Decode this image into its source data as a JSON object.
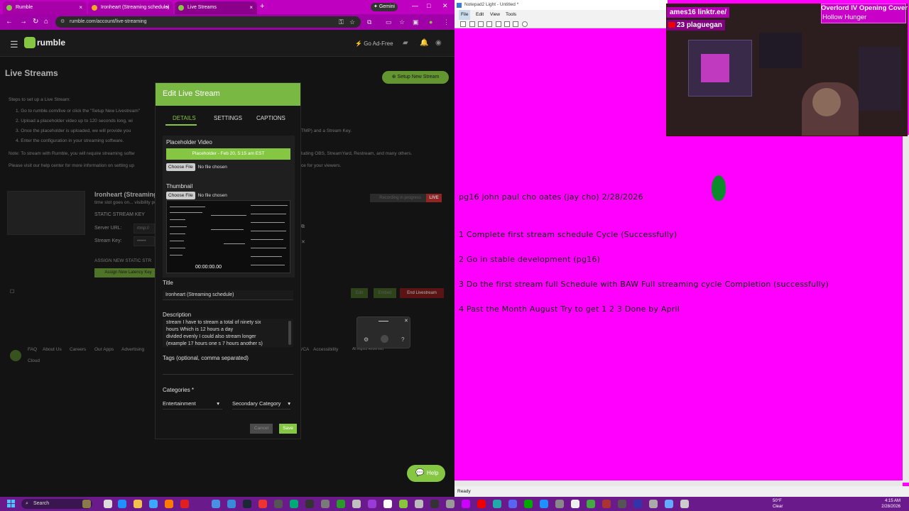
{
  "browser": {
    "tabs": [
      {
        "label": "Rumble"
      },
      {
        "label": "Ironheart (Streaming schedule)"
      },
      {
        "label": "Live Streams"
      }
    ],
    "gemini_label": "Gemini",
    "url": "rumble.com/account/live-streaming"
  },
  "rumble": {
    "logo_text": "rumble",
    "go_adfree": "Go Ad-Free",
    "page_title": "Live Streams",
    "setup_button": "Setup New Stream",
    "steps_heading": "Steps to set up a Live Stream:",
    "steps": [
      "1. Go to rumble.com/live or click the \"Setup New Livestream\"",
      "2. Upload a placeholder video up to 120 seconds long, wi",
      "3. Once the placeholder is uploaded, we will provide you",
      "4. Enter the configuration in your streaming software."
    ],
    "steps_right_3": "TMP) and a Stream Key.",
    "note_left": "Note: To stream with Rumble, you will require streaming softw",
    "note_right": "luding OBS, StreamYard, Restream, and many others.",
    "visit_left": "Please visit our help center for more information on setting up",
    "visit_right": "ce for your viewers.",
    "stream_title": "Ironheart (Streaming",
    "stream_sub": "time slot goes on... visibility pub",
    "static_key_label": "STATIC STREAM KEY",
    "server_url_label": "Server URL:",
    "server_url_value": "rtmp://",
    "stream_key_label": "Stream Key:",
    "stream_key_value": "••••••",
    "assign_label": "ASSIGN NEW STATIC STR",
    "assign_button": "Assign New Latency Key",
    "recording_badge": "Recording in progress",
    "live_badge": "LIVE",
    "edit_button": "Edit",
    "embed_button": "Embed",
    "end_button": "End Livestream",
    "footer_links": [
      "FAQ",
      "About Us",
      "Careers",
      "Our Apps",
      "Advertising"
    ],
    "footer_cloud": "Cloud",
    "footer_right": [
      "VCA",
      "Accessibility"
    ],
    "footer_rights": "All Rights Reserved",
    "help_label": "Help"
  },
  "modal": {
    "title": "Edit Live Stream",
    "tabs": [
      "DETAILS",
      "SETTINGS",
      "CAPTIONS"
    ],
    "placeholder_label": "Placeholder Video",
    "placeholder_value": "Placeholder - Feb 20, 5:15 am EST",
    "choose_file": "Choose File",
    "no_file": "No file chosen",
    "thumbnail_label": "Thumbnail",
    "thumb_time": "00:00:00.00",
    "title_label": "Title",
    "title_value": "Ironheart (Streaming schedule)",
    "description_label": "Description",
    "description_lines": [
      "stream I have to stream a total of ninety six",
      "hours Which is 12 hours a day",
      "divided evenly I could also stream longer",
      "(example 17 hours one s 7 hours another s)"
    ],
    "tags_label": "Tags (optional, comma separated)",
    "categories_label": "Categories *",
    "primary_category": "Entertainment",
    "secondary_category": "Secondary Category",
    "cancel_button": "Cancel",
    "save_button": "Save"
  },
  "notepad": {
    "title": "Notepad2 Light - Untitled *",
    "menus": [
      "File",
      "Edit",
      "View",
      "Tools"
    ],
    "lines": [
      "pg16 john paul cho oates (jay cho) 2/28/2026",
      "1 Complete first stream schedule Cycle (Successfully)",
      "2 Go in stable development (pg16)",
      "3 Do the first stream full Schedule with BAW Full streaming cycle Completion (successfully)",
      "4 Past the Month August Try to get 1 2 3 Done by April"
    ],
    "status": "Ready"
  },
  "overlay": {
    "cam_label_1": "ames16 linktr.ee/",
    "cam_label_2": "23 plaguegan",
    "song_title": "Overlord IV Opening Cover",
    "song_artist": "Hollow Hunger"
  },
  "taskbar": {
    "search_placeholder": "Search",
    "weather_temp": "50°F",
    "weather_desc": "Clear",
    "time": "4:15 AM",
    "date": "2/28/2026"
  }
}
